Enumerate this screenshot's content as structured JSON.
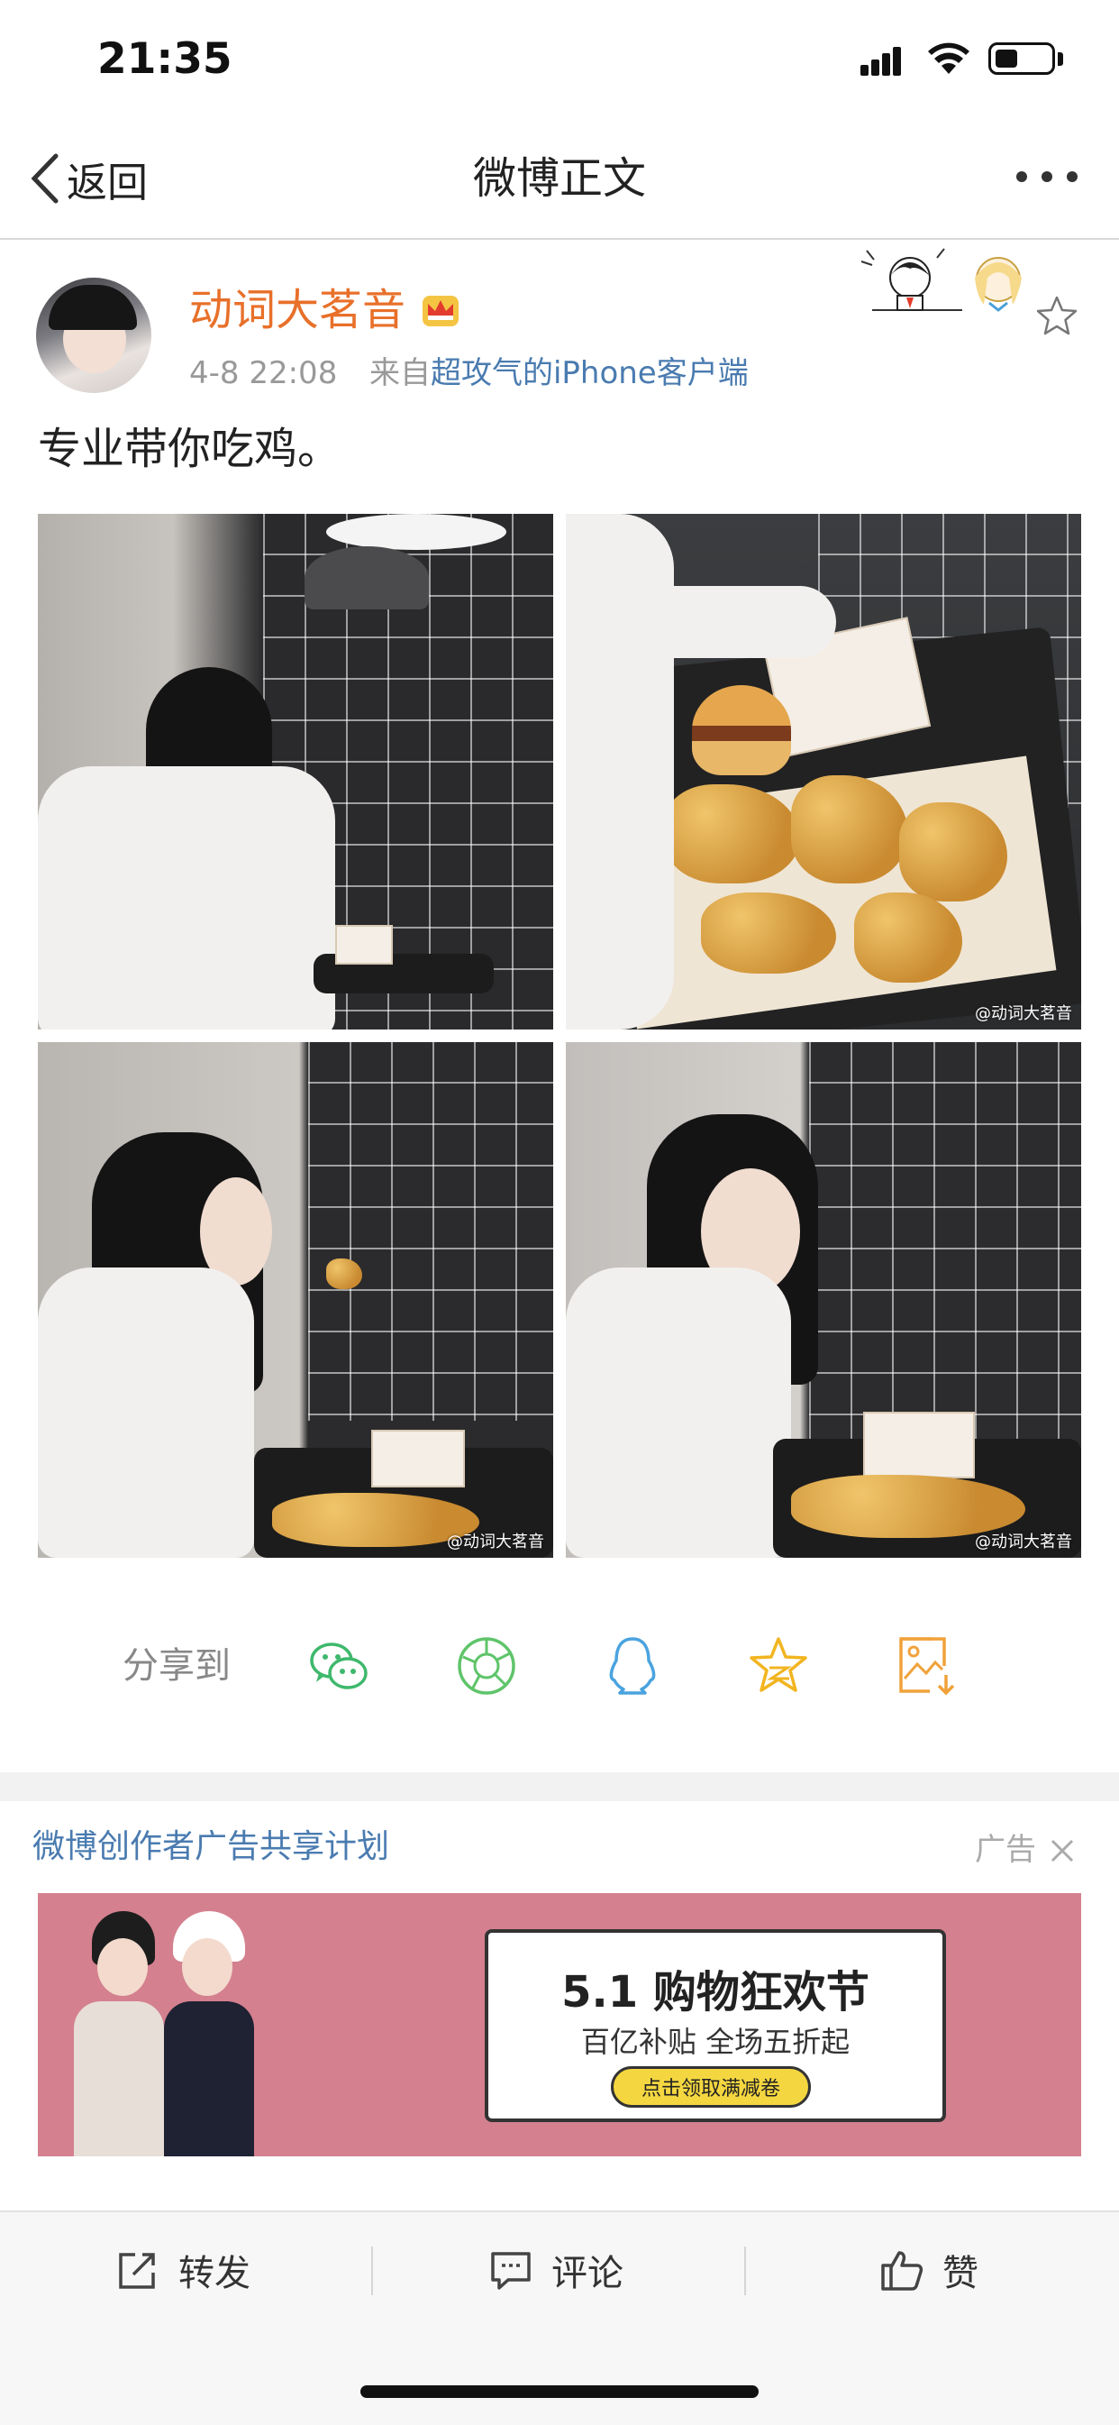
{
  "status_bar": {
    "time": "21:35"
  },
  "nav": {
    "back_label": "返回",
    "title": "微博正文"
  },
  "post": {
    "author": "动词大茗音",
    "date": "4-8 22:08",
    "source_prefix": "来自",
    "source": "超攻气的iPhone客户端",
    "text": "专业带你吃鸡。",
    "watermark": "@动词大茗音"
  },
  "share": {
    "label": "分享到",
    "icons": [
      "wechat-icon",
      "moments-icon",
      "qq-icon",
      "qzone-icon",
      "save-image-icon"
    ]
  },
  "ad": {
    "label": "微博创作者广告共享计划",
    "tag": "广告",
    "headline": "5.1 购物狂欢节",
    "subline": "百亿补贴  全场五折起",
    "button": "点击领取满减卷"
  },
  "actions": {
    "repost": "转发",
    "comment": "评论",
    "like": "赞"
  },
  "colors": {
    "author": "#e8702a",
    "link": "#4a7bb0",
    "share_green": "#3eb86c",
    "star_gold": "#f2b520",
    "ad_bg": "#d4808f"
  }
}
